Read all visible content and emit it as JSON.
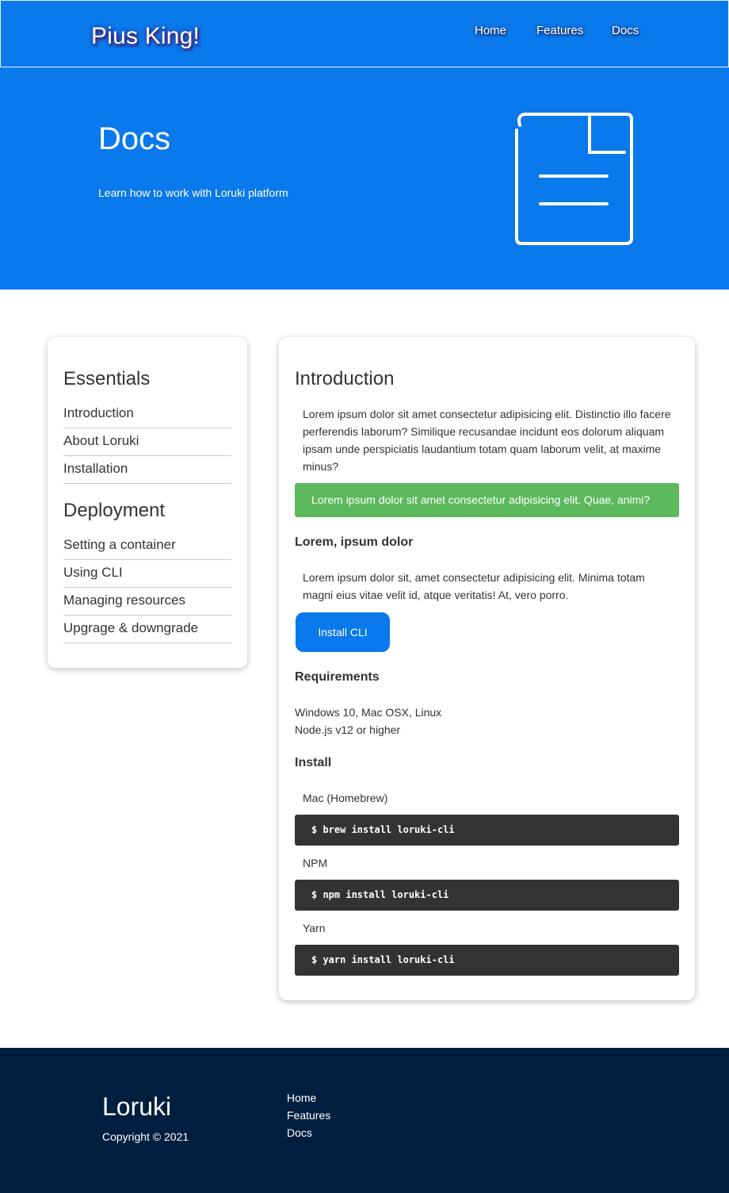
{
  "navbar": {
    "brand": "Pius King!",
    "links": [
      "Home",
      "Features",
      "Docs"
    ]
  },
  "hero": {
    "title": "Docs",
    "subtitle": "Learn how to work with Loruki platform",
    "icon": "document-icon"
  },
  "sidebar": {
    "sections": [
      {
        "heading": "Essentials",
        "items": [
          "Introduction",
          "About Loruki",
          "Installation"
        ]
      },
      {
        "heading": "Deployment",
        "items": [
          "Setting a container",
          "Using CLI",
          "Managing resources",
          "Upgrage & downgrade"
        ]
      }
    ]
  },
  "main": {
    "title": "Introduction",
    "intro": "Lorem ipsum dolor sit amet consectetur adipisicing elit. Distinctio illo facere perferendis laborum? Similique recusandae incidunt eos dolorum aliquam ipsam unde perspiciatis laudantium totam quam laborum velit, at maxime minus?",
    "alert": "Lorem ipsum dolor sit amet consectetur adipisicing elit. Quae, animi?",
    "subheading": "Lorem, ipsum dolor",
    "sub_text": "Lorem ipsum dolor sit, amet consectetur adipisicing elit. Minima totam magni eius vitae velit id, atque veritatis! At, vero porro.",
    "button": "Install CLI",
    "requirements": {
      "heading": "Requirements",
      "lines": [
        "Windows 10, Mac OSX, Linux",
        "Node.js v12 or higher"
      ]
    },
    "install": {
      "heading": "Install",
      "blocks": [
        {
          "label": "Mac (Homebrew)",
          "code": "$ brew install loruki-cli"
        },
        {
          "label": "NPM",
          "code": "$ npm install loruki-cli"
        },
        {
          "label": "Yarn",
          "code": "$ yarn install loruki-cli"
        }
      ]
    }
  },
  "footer": {
    "brand": "Loruki",
    "copyright": "Copyright © 2021",
    "links": [
      "Home",
      "Features",
      "Docs"
    ]
  },
  "colors": {
    "primary": "#0a79eb",
    "success": "#5cb85c",
    "code_bg": "#333333",
    "footer_bg": "#001f3f"
  }
}
